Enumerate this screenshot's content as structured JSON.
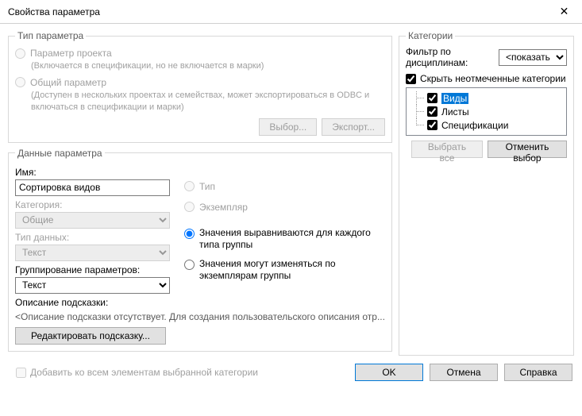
{
  "window": {
    "title": "Свойства параметра"
  },
  "param_type": {
    "legend": "Тип параметра",
    "project_label": "Параметр проекта",
    "project_hint": "(Включается в спецификации, но не включается в марки)",
    "shared_label": "Общий параметр",
    "shared_hint": "(Доступен в нескольких проектах и семействах, может экспортироваться в ODBC и включаться в спецификации и марки)",
    "btn_choose": "Выбор...",
    "btn_export": "Экспорт..."
  },
  "param_data": {
    "legend": "Данные параметра",
    "name_label": "Имя:",
    "name_value": "Сортировка видов",
    "category_label": "Категория:",
    "category_value": "Общие",
    "datatype_label": "Тип данных:",
    "datatype_value": "Текст",
    "grouping_label": "Группирование параметров:",
    "grouping_value": "Текст",
    "radio_type": "Тип",
    "radio_instance": "Экземпляр",
    "radio_align": "Значения выравниваются для каждого типа группы",
    "radio_vary": "Значения могут изменяться по экземплярам группы",
    "tooltip_label": "Описание подсказки:",
    "tooltip_desc": "<Описание подсказки отсутствует. Для создания пользовательского описания отр...",
    "btn_edit_tooltip": "Редактировать подсказку..."
  },
  "categories": {
    "legend": "Категории",
    "filter_label": "Фильтр по дисциплинам:",
    "filter_value": "<показать",
    "hide_unchecked": "Скрыть неотмеченные категории",
    "items": [
      {
        "label": "Виды",
        "checked": true,
        "selected": true
      },
      {
        "label": "Листы",
        "checked": true,
        "selected": false
      },
      {
        "label": "Спецификации",
        "checked": true,
        "selected": false
      }
    ],
    "btn_select_all": "Выбрать все",
    "btn_deselect": "Отменить выбор"
  },
  "footer": {
    "add_all": "Добавить ко всем элементам выбранной категории",
    "ok": "OK",
    "cancel": "Отмена",
    "help": "Справка"
  }
}
